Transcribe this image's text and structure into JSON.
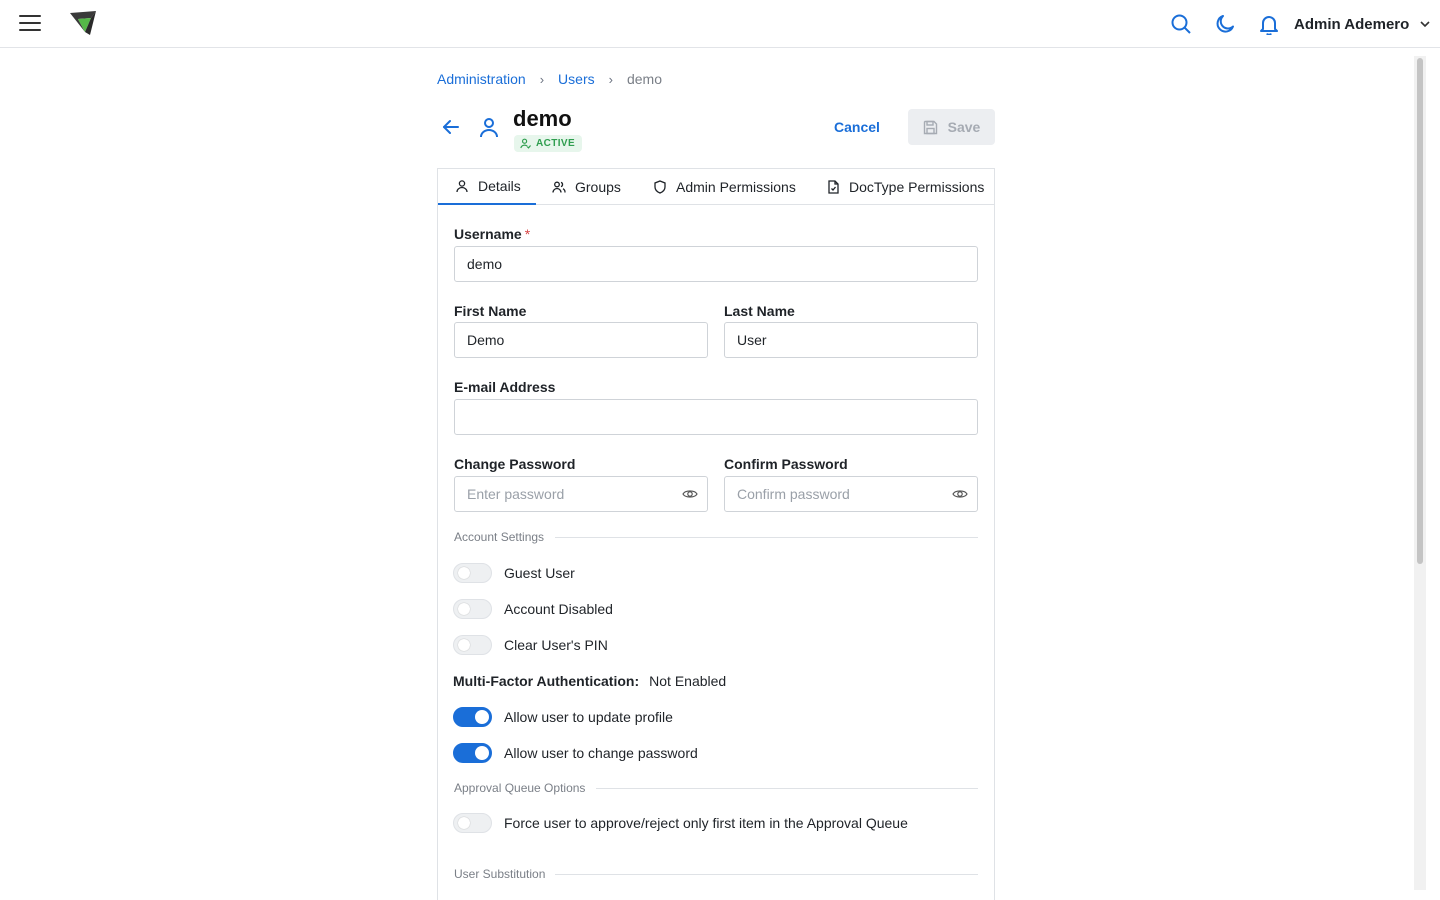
{
  "app": {
    "user_display_name": "Admin Ademero"
  },
  "breadcrumb": {
    "items": [
      "Administration",
      "Users"
    ],
    "current": "demo"
  },
  "header": {
    "title": "demo",
    "status_badge": "ACTIVE",
    "cancel_label": "Cancel",
    "save_label": "Save"
  },
  "tabs": [
    {
      "label": "Details",
      "icon": "user-icon",
      "active": true
    },
    {
      "label": "Groups",
      "icon": "users-icon",
      "active": false
    },
    {
      "label": "Admin Permissions",
      "icon": "shield-icon",
      "active": false
    },
    {
      "label": "DocType Permissions",
      "icon": "file-icon",
      "active": false
    }
  ],
  "form": {
    "username": {
      "label": "Username",
      "required_mark": "*",
      "value": "demo"
    },
    "first_name": {
      "label": "First Name",
      "value": "Demo"
    },
    "last_name": {
      "label": "Last Name",
      "value": "User"
    },
    "email": {
      "label": "E-mail Address",
      "value": ""
    },
    "change_password": {
      "label": "Change Password",
      "placeholder": "Enter password",
      "value": ""
    },
    "confirm_password": {
      "label": "Confirm Password",
      "placeholder": "Confirm password",
      "value": ""
    }
  },
  "account_settings": {
    "title": "Account Settings",
    "toggles": [
      {
        "label": "Guest User",
        "on": false
      },
      {
        "label": "Account Disabled",
        "on": false
      },
      {
        "label": "Clear User's PIN",
        "on": false
      }
    ]
  },
  "mfa": {
    "label": "Multi-Factor Authentication:",
    "value": "Not Enabled"
  },
  "profile_toggles": [
    {
      "label": "Allow user to update profile",
      "on": true
    },
    {
      "label": "Allow user to change password",
      "on": true
    }
  ],
  "approval_queue": {
    "title": "Approval Queue Options",
    "toggle": {
      "label": "Force user to approve/reject only first item in the Approval Queue",
      "on": false
    }
  },
  "user_substitution": {
    "title": "User Substitution"
  },
  "colors": {
    "accent": "#1a6ed8",
    "active_badge_bg": "#e7f6ec",
    "active_badge_text": "#2f9e4f",
    "required": "#d64545"
  }
}
